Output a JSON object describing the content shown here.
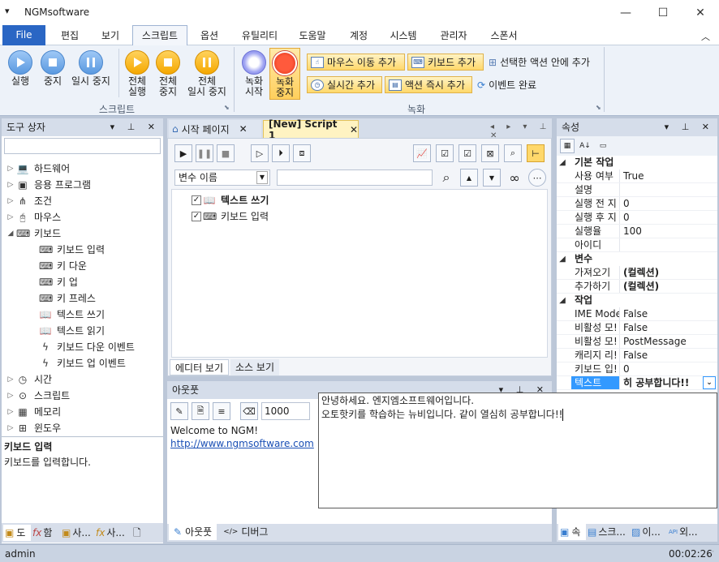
{
  "window": {
    "title": "NGMsoftware",
    "quick_access": "▾"
  },
  "menu_tabs": [
    "편집",
    "보기",
    "스크립트",
    "옵션",
    "유틸리티",
    "도움말",
    "계정",
    "시스템",
    "관리자",
    "스폰서"
  ],
  "file_label": "File",
  "ribbon": {
    "script_group": "스크립트",
    "record_group": "녹화",
    "run": "실행",
    "stop": "중지",
    "pause": "일시 중지",
    "all_run": [
      "전체",
      "실행"
    ],
    "all_stop": [
      "전체",
      "중지"
    ],
    "all_pause": [
      "전체",
      "일시 중지"
    ],
    "rec_start": [
      "녹화",
      "시작"
    ],
    "rec_stop": [
      "녹화",
      "중지"
    ],
    "mouse_move_add": "마우스 이동 추가",
    "keyboard_add": "키보드 추가",
    "add_in_selected": "선택한 액션 안에 추가",
    "realtime_add": "실시간 추가",
    "action_instant_add": "액션 즉시 추가",
    "event_complete": "이벤트 완료"
  },
  "toolbox": {
    "title": "도구 상자",
    "search_placeholder": "",
    "items": [
      {
        "label": "하드웨어",
        "icon": "computer-icon",
        "expander": "▷",
        "indent": 0
      },
      {
        "label": "응용 프로그램",
        "icon": "application-icon",
        "expander": "▷",
        "indent": 0
      },
      {
        "label": "조건",
        "icon": "condition-icon",
        "expander": "▷",
        "indent": 0
      },
      {
        "label": "마우스",
        "icon": "mouse-icon",
        "expander": "▷",
        "indent": 0
      },
      {
        "label": "키보드",
        "icon": "keyboard-icon",
        "expander": "◢",
        "indent": 0
      },
      {
        "label": "키보드 입력",
        "icon": "keyboard-icon",
        "expander": "",
        "indent": 1
      },
      {
        "label": "키 다운",
        "icon": "key-down-icon",
        "expander": "",
        "indent": 1
      },
      {
        "label": "키 업",
        "icon": "key-up-icon",
        "expander": "",
        "indent": 1
      },
      {
        "label": "키 프레스",
        "icon": "key-press-icon",
        "expander": "",
        "indent": 1
      },
      {
        "label": "텍스트 쓰기",
        "icon": "book-icon",
        "expander": "",
        "indent": 1
      },
      {
        "label": "텍스트 읽기",
        "icon": "book-read-icon",
        "expander": "",
        "indent": 1
      },
      {
        "label": "키보드 다운 이벤트",
        "icon": "lightning-icon",
        "expander": "",
        "indent": 1
      },
      {
        "label": "키보드 업 이벤트",
        "icon": "lightning-icon",
        "expander": "",
        "indent": 1
      },
      {
        "label": "시간",
        "icon": "clock-icon",
        "expander": "▷",
        "indent": 0
      },
      {
        "label": "스크립트",
        "icon": "script-icon",
        "expander": "▷",
        "indent": 0
      },
      {
        "label": "메모리",
        "icon": "memory-icon",
        "expander": "▷",
        "indent": 0
      },
      {
        "label": "윈도우",
        "icon": "windows-icon",
        "expander": "▷",
        "indent": 0
      }
    ],
    "desc_title": "키보드 입력",
    "desc_text": "키보드를 입력합니다.",
    "bottom_tabs": [
      "도",
      "함",
      "사...",
      "사...",
      ""
    ]
  },
  "editor": {
    "tabs": [
      "시작 페이지",
      "[New] Script 1"
    ],
    "var_select": "변수 이름",
    "var_input": "",
    "actions": [
      {
        "label": "텍스트 쓰기",
        "bold": true,
        "checked": "✓"
      },
      {
        "label": "키보드 입력",
        "bold": false,
        "checked": "✓"
      }
    ],
    "view_tabs": [
      "에디터 보기",
      "소스 보기"
    ]
  },
  "output": {
    "title": "아웃풋",
    "delay": "1000",
    "lines": [
      "Welcome to NGM!",
      "http://www.ngmsoftware.com"
    ],
    "bottom_tabs": [
      "아웃풋",
      "디버그"
    ]
  },
  "properties": {
    "title": "속성",
    "categories": [
      {
        "name": "기본 작업",
        "rows": [
          [
            "사용 여부",
            "True"
          ],
          [
            "설명",
            ""
          ],
          [
            "실행 전 지",
            "0"
          ],
          [
            "실행 후 지",
            "0"
          ],
          [
            "실행율",
            "100"
          ],
          [
            "아이디",
            ""
          ]
        ]
      },
      {
        "name": "변수",
        "rows": [
          [
            "가져오기",
            "(컬렉션)"
          ],
          [
            "추가하기",
            "(컬렉션)"
          ]
        ]
      },
      {
        "name": "작업",
        "rows": [
          [
            "IME Mode",
            "False"
          ],
          [
            "비활성 모!",
            "False"
          ],
          [
            "비활성 모!",
            "PostMessage"
          ],
          [
            "캐리지 리!",
            "False"
          ],
          [
            "키보드 입!",
            "0"
          ],
          [
            "텍스트",
            "히 공부합니다!!"
          ]
        ]
      }
    ],
    "bottom_tabs": [
      "속",
      "스크...",
      "이...",
      "외..."
    ]
  },
  "popup_text": [
    "안녕하세요. 엔지엠소프트웨어입니다.",
    "오토핫키를 학습하는 뉴비입니다. 같이 열심히 공부합니다!!"
  ],
  "status": {
    "user": "admin",
    "time": "00:02:26"
  }
}
